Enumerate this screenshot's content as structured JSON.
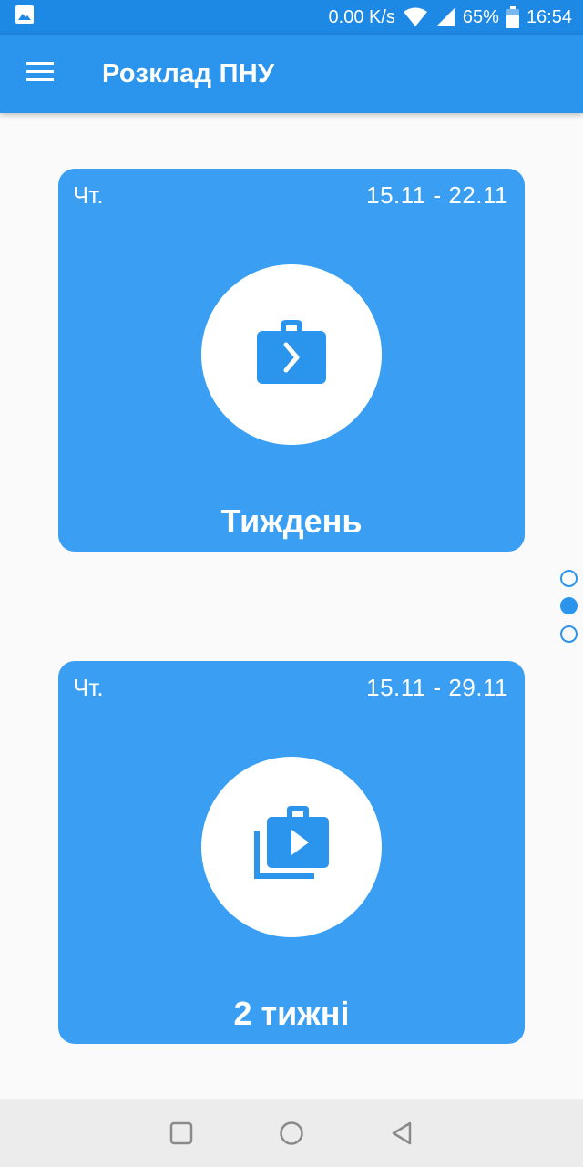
{
  "status_bar": {
    "network_speed": "0.00 K/s",
    "battery_percent": "65%",
    "time": "16:54",
    "icons": [
      "image-notification-icon",
      "wifi-icon",
      "signal-icon",
      "battery-icon"
    ]
  },
  "app_bar": {
    "title": "Розклад ПНУ",
    "menu_icon": "menu-icon"
  },
  "cards": [
    {
      "day": "Чт.",
      "range": "15.11 - 22.11",
      "label": "Тиждень",
      "icon": "work-arrow-icon"
    },
    {
      "day": "Чт.",
      "range": "15.11 - 29.11",
      "label": "2 тижні",
      "icon": "work-stack-play-icon"
    }
  ],
  "pager": {
    "count": 3,
    "active_index": 1
  },
  "colors": {
    "primary": "#2b95ee",
    "status_bar": "#1e88e5",
    "card": "#3a9ff2",
    "background": "#fafafa"
  },
  "nav_bar": {
    "icons": [
      "recents-icon",
      "home-icon",
      "back-icon"
    ]
  }
}
